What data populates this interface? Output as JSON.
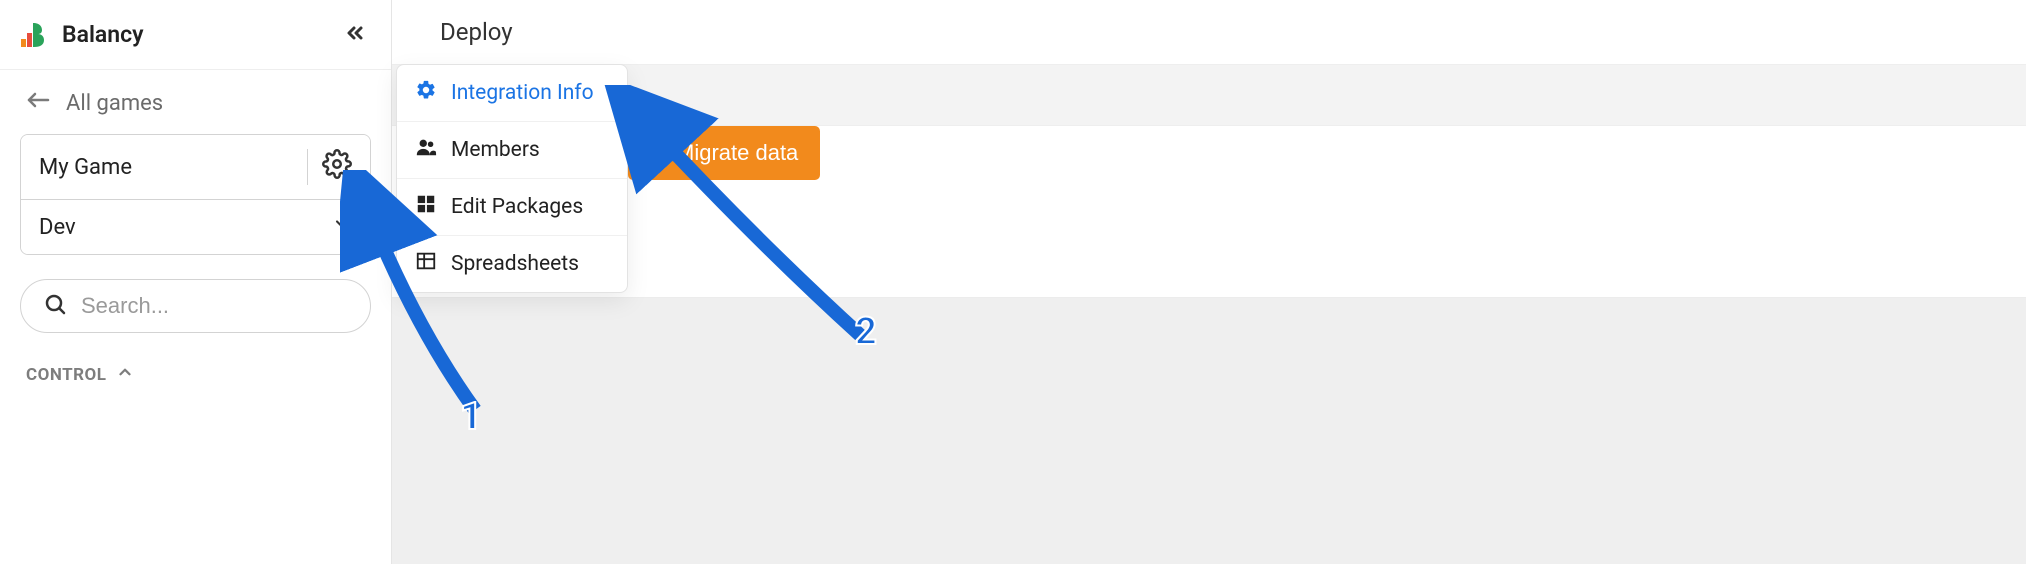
{
  "app": {
    "name": "Balancy"
  },
  "sidebar": {
    "back_label": "All games",
    "game_name": "My Game",
    "env_name": "Dev",
    "search_placeholder": "Search...",
    "section_control": "CONTROL"
  },
  "header": {
    "title": "Deploy"
  },
  "dropdown": {
    "items": [
      "Integration Info",
      "Members",
      "Edit Packages",
      "Spreadsheets"
    ]
  },
  "buttons": {
    "migrate": "Migrate data"
  },
  "annotations": {
    "arrow1_label": "1",
    "arrow2_label": "2"
  }
}
